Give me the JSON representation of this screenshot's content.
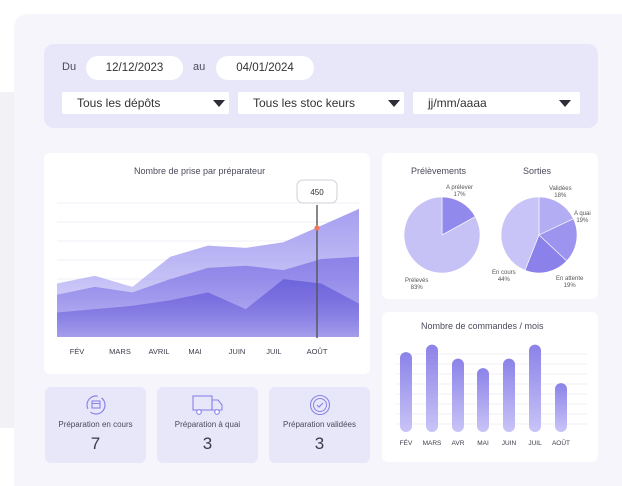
{
  "filters": {
    "from_label": "Du",
    "from_date": "12/12/2023",
    "to_label": "au",
    "to_date": "04/01/2024",
    "depot_select": "Tous les dépôts",
    "stockkeeper_select": "Tous les stoc keurs",
    "date_input_placeholder": "jj/mm/aaaa"
  },
  "area_chart": {
    "title": "Nombre de prise par préparateur",
    "tooltip_value": "450"
  },
  "pies": {
    "prelevements_title": "Prélèvements",
    "sorties_title": "Sorties",
    "prelevements_slices": [
      {
        "label": "A prélever",
        "pct": "17%"
      },
      {
        "label": "Prélevés",
        "pct": "83%"
      }
    ],
    "sorties_slices": [
      {
        "label": "Validées",
        "pct": "18%"
      },
      {
        "label": "A quai",
        "pct": "19%"
      },
      {
        "label": "En attente",
        "pct": "19%"
      },
      {
        "label": "En cours",
        "pct": "44%"
      }
    ]
  },
  "bar_chart": {
    "title": "Nombre de commandes / mois"
  },
  "stats": [
    {
      "label": "Préparation en cours",
      "value": "7",
      "icon": "refresh-box-icon"
    },
    {
      "label": "Préparation à quai",
      "value": "3",
      "icon": "truck-icon"
    },
    {
      "label": "Préparation validées",
      "value": "3",
      "icon": "check-circle-icon"
    }
  ],
  "chart_data": [
    {
      "type": "area",
      "title": "Nombre de prise par préparateur",
      "categories": [
        "FÉV",
        "MARS",
        "AVRIL",
        "MAI",
        "JUIN",
        "JUIL",
        "AOÛT"
      ],
      "series": [
        {
          "values": [
            48,
            55,
            45,
            72,
            82,
            80,
            85,
            100,
            115
          ]
        },
        {
          "values": [
            38,
            45,
            40,
            52,
            62,
            64,
            60,
            70,
            72
          ]
        },
        {
          "values": [
            22,
            25,
            28,
            33,
            40,
            25,
            52,
            48,
            30
          ]
        }
      ],
      "colors": [
        "#a59ef0",
        "#8b82e8",
        "#6f65dc"
      ],
      "highlight": {
        "category": "AOÛT",
        "value": "450"
      }
    },
    {
      "type": "pie",
      "title": "Prélèvements",
      "labels": [
        "A prélever",
        "Prélevés"
      ],
      "values": [
        17,
        83
      ],
      "colors": [
        "#9189ec",
        "#c7c2f6"
      ]
    },
    {
      "type": "pie",
      "title": "Sorties",
      "labels": [
        "Validées",
        "A quai",
        "En attente",
        "En cours"
      ],
      "values": [
        18,
        19,
        19,
        44
      ],
      "colors": [
        "#b3adf3",
        "#9c94ef",
        "#8a81ea",
        "#c9c4f7"
      ]
    },
    {
      "type": "bar",
      "title": "Nombre de commandes / mois",
      "categories": [
        "FÉV",
        "MARS",
        "AVR",
        "MAI",
        "JUIN",
        "JUIL",
        "AOÛT"
      ],
      "values": [
        85,
        93,
        78,
        68,
        78,
        93,
        52
      ],
      "color": "#8b82e8"
    }
  ]
}
